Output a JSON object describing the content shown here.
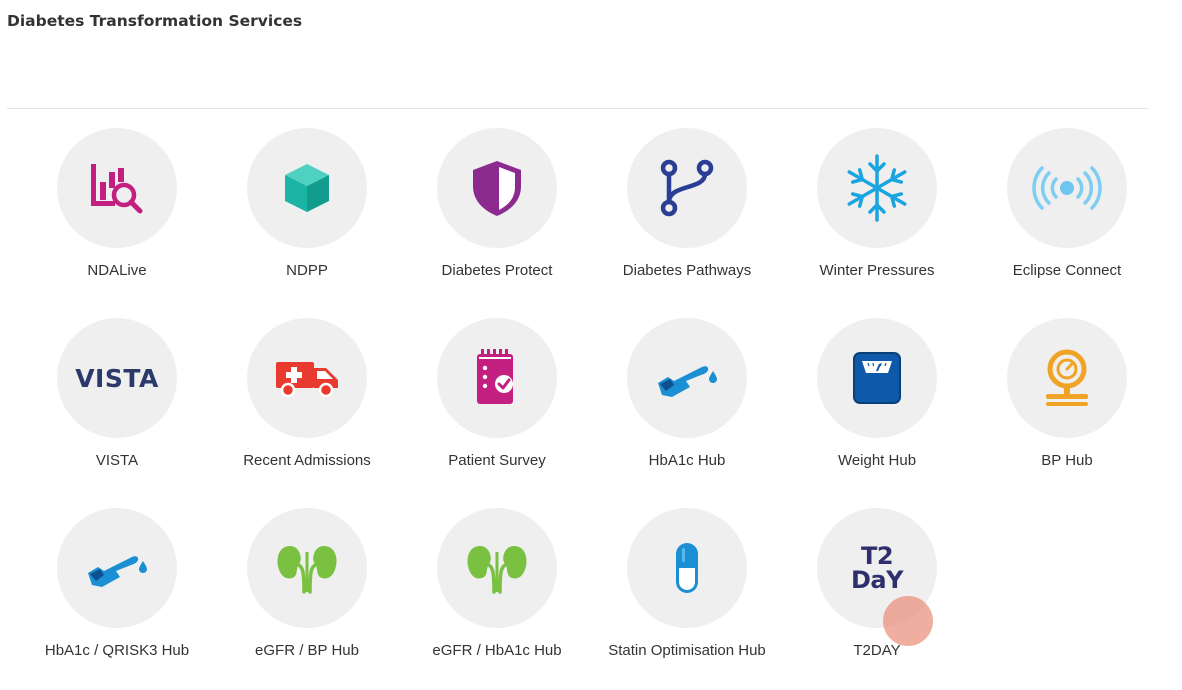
{
  "page": {
    "title": "Diabetes Transformation Services"
  },
  "tiles": [
    {
      "label": "NDALive",
      "icon": "chart-search-icon"
    },
    {
      "label": "NDPP",
      "icon": "cube-icon"
    },
    {
      "label": "Diabetes Protect",
      "icon": "shield-icon"
    },
    {
      "label": "Diabetes Pathways",
      "icon": "branch-icon"
    },
    {
      "label": "Winter Pressures",
      "icon": "snowflake-icon"
    },
    {
      "label": "Eclipse Connect",
      "icon": "broadcast-icon"
    },
    {
      "label": "VISTA",
      "icon": "vista-logo",
      "logo_text": "VISTA"
    },
    {
      "label": "Recent Admissions",
      "icon": "ambulance-icon"
    },
    {
      "label": "Patient Survey",
      "icon": "clipboard-check-icon"
    },
    {
      "label": "HbA1c Hub",
      "icon": "finger-prick-icon"
    },
    {
      "label": "Weight Hub",
      "icon": "weighing-scale-icon"
    },
    {
      "label": "BP Hub",
      "icon": "blood-pressure-gauge-icon"
    },
    {
      "label": "HbA1c / QRISK3 Hub",
      "icon": "finger-prick-icon"
    },
    {
      "label": "eGFR / BP Hub",
      "icon": "kidneys-icon"
    },
    {
      "label": "eGFR / HbA1c Hub",
      "icon": "kidneys-icon"
    },
    {
      "label": "Statin Optimisation Hub",
      "icon": "capsule-icon"
    },
    {
      "label": "T2DAY",
      "icon": "t2day-logo",
      "logo_line1": "T2",
      "logo_line2": "DaY"
    }
  ],
  "colors": {
    "circle_bg": "#efefef",
    "magenta": "#c21f80",
    "teal": "#1ab5a5",
    "purple": "#8b2a8f",
    "navy": "#2a3e96",
    "sky": "#1ba5e0",
    "light_blue": "#7fcdf2",
    "red": "#e83a2f",
    "blue": "#1a8fd3",
    "dark_blue": "#0f5aa8",
    "orange": "#f0a325",
    "green": "#7ac142"
  }
}
